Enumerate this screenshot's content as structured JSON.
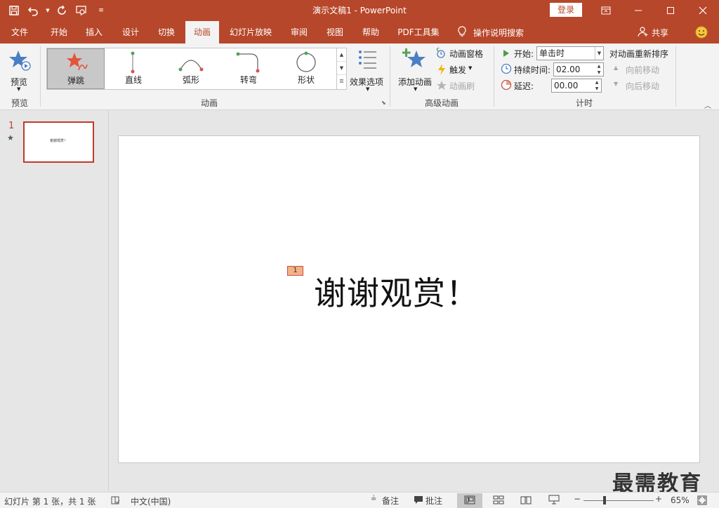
{
  "titlebar": {
    "doc_title": "演示文稿1  -  PowerPoint",
    "login_label": "登录"
  },
  "tabs": [
    {
      "id": "file",
      "label": "文件"
    },
    {
      "id": "home",
      "label": "开始"
    },
    {
      "id": "insert",
      "label": "插入"
    },
    {
      "id": "design",
      "label": "设计"
    },
    {
      "id": "transitions",
      "label": "切换"
    },
    {
      "id": "animations",
      "label": "动画",
      "active": true
    },
    {
      "id": "slideshow",
      "label": "幻灯片放映"
    },
    {
      "id": "review",
      "label": "审阅"
    },
    {
      "id": "view",
      "label": "视图"
    },
    {
      "id": "help",
      "label": "帮助"
    },
    {
      "id": "pdf",
      "label": "PDF工具集"
    }
  ],
  "tellme_label": "操作说明搜索",
  "share_label": "共享",
  "ribbon": {
    "preview": {
      "button_label": "预览",
      "group_label": "预览"
    },
    "animation": {
      "group_label": "动画",
      "gallery": [
        {
          "label": "弹跳",
          "selected": true
        },
        {
          "label": "直线"
        },
        {
          "label": "弧形"
        },
        {
          "label": "转弯"
        },
        {
          "label": "形状"
        }
      ],
      "effect_options_label": "效果选项"
    },
    "advanced": {
      "group_label": "高级动画",
      "add_animation_label": "添加动画",
      "animation_pane_label": "动画窗格",
      "trigger_label": "触发",
      "painter_label": "动画刷"
    },
    "timing": {
      "group_label": "计时",
      "start_label": "开始:",
      "start_value": "单击时",
      "duration_label": "持续时间:",
      "duration_value": "02.00",
      "delay_label": "延迟:",
      "delay_value": "00.00",
      "reorder_label": "对动画重新排序",
      "move_earlier_label": "向前移动",
      "move_later_label": "向后移动"
    }
  },
  "thumbnails": [
    {
      "number": "1",
      "star": "★",
      "text": "谢谢观赏！"
    }
  ],
  "slide": {
    "anim_tag": "1",
    "text": "谢谢观赏！"
  },
  "watermark": "最需教育",
  "statusbar": {
    "slide_info": "幻灯片 第 1 张，共 1 张",
    "language": "中文(中国)",
    "notes_label": "备注",
    "comments_label": "批注",
    "zoom_value": "65%"
  },
  "colors": {
    "brand": "#b7472a",
    "anim_tag": "#f4b183",
    "selected_gallery": "#c8c8c8"
  }
}
